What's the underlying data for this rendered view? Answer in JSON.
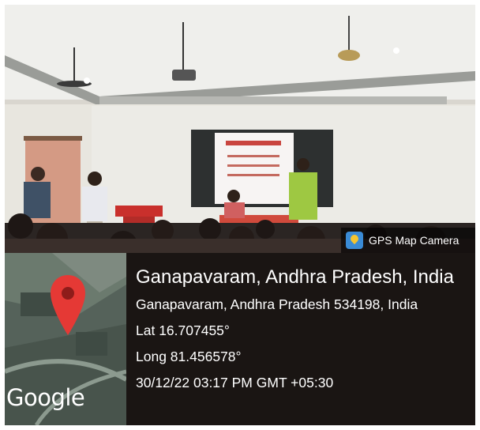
{
  "badge": {
    "label": "GPS Map Camera",
    "icon": "gps-map-camera-icon"
  },
  "map": {
    "logo": "Google",
    "pin_icon": "location-pin-icon",
    "pin_color": "#e53935"
  },
  "location": {
    "title": "Ganapavaram, Andhra Pradesh, India",
    "address": "Ganapavaram, Andhra Pradesh 534198, India",
    "lat": "Lat 16.707455°",
    "long": "Long 81.456578°",
    "datetime": "30/12/22 03:17 PM GMT +05:30"
  }
}
